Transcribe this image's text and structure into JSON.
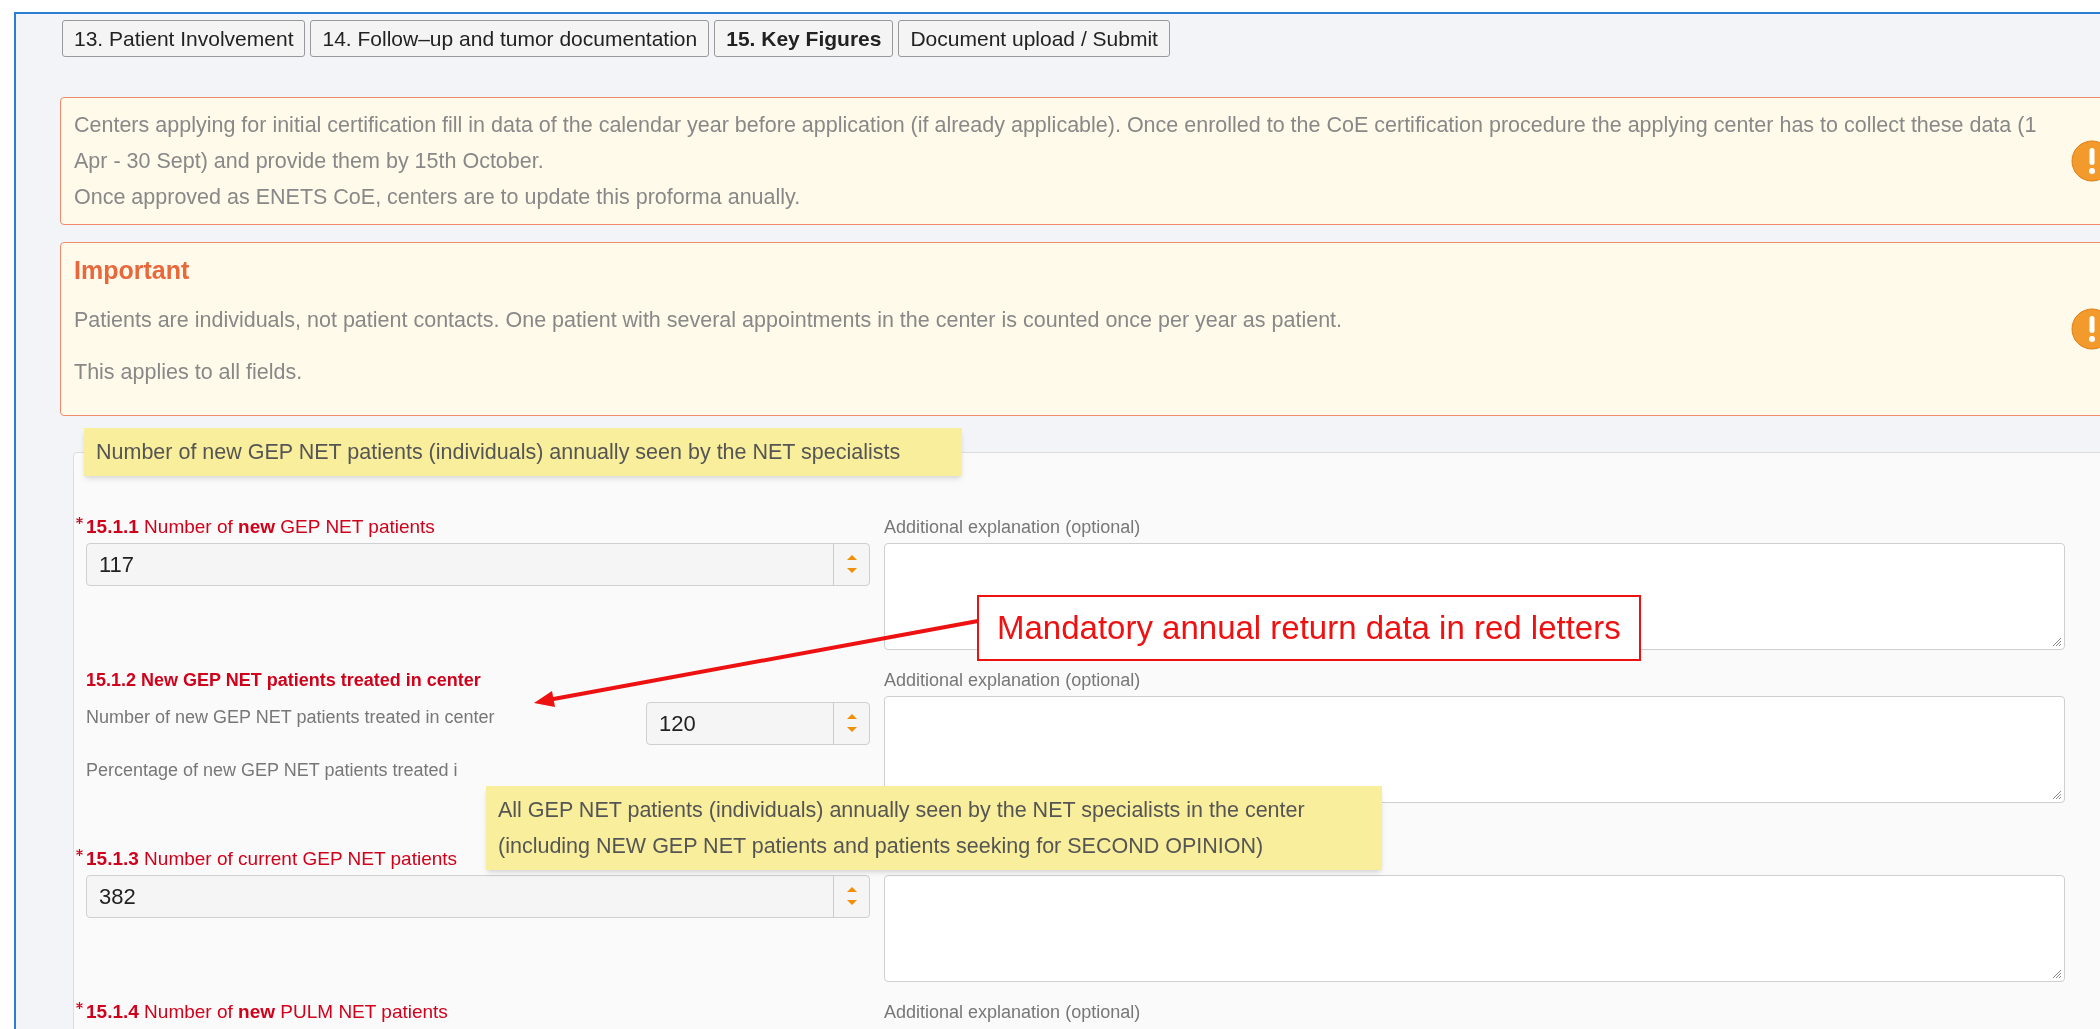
{
  "tabs": [
    {
      "label": "13. Patient Involvement",
      "selected": false
    },
    {
      "label": "14. Follow–up and tumor documentation",
      "selected": false
    },
    {
      "label": "15. Key Figures",
      "selected": true
    },
    {
      "label": "Document upload / Submit",
      "selected": false
    }
  ],
  "notices": [
    {
      "paragraphs": [
        "Centers applying for initial certification fill in data of the calendar year before application (if already applicable). Once enrolled to the CoE certification procedure the applying center has to collect these data (1 Apr - 30 Sept) and provide them by 15th October.",
        "Once approved as ENETS CoE, centers are to update this proforma anually."
      ]
    },
    {
      "title": "Important",
      "paragraphs": [
        "Patients are individuals, not patient contacts. One patient with several appointments in the center is counted once per year as patient.",
        "This applies to all fields."
      ]
    }
  ],
  "fields": [
    {
      "kind": "number",
      "required": true,
      "label": "**15.1.1** Number of **new** GEP NET patients",
      "value": "117",
      "explanation_label": "Additional explanation (optional)"
    },
    {
      "kind": "group",
      "title": "15.1.2 New GEP NET patients treated in center",
      "rows": [
        {
          "label": "Number of new GEP NET patients treated in center",
          "value": "120"
        }
      ],
      "partial_label": "Percentage of new GEP NET patients treated i",
      "explanation_label": "Additional explanation (optional)"
    },
    {
      "kind": "number",
      "required": true,
      "label": "**15.1.3** Number of current GEP NET patients",
      "value": "382"
    },
    {
      "kind": "label",
      "required": true,
      "label": "**15.1.4** Number of **new** PULM NET patients",
      "explanation_label": "Additional explanation (optional)"
    }
  ],
  "tooltips": [
    "Number of new GEP NET patients (individuals) annually seen by the NET specialists",
    "All GEP NET patients (individuals) annually seen by the NET specialists in the center (including NEW GEP NET patients and patients seeking for SECOND OPINION)"
  ],
  "annotation": "Mandatory annual return data in red letters"
}
